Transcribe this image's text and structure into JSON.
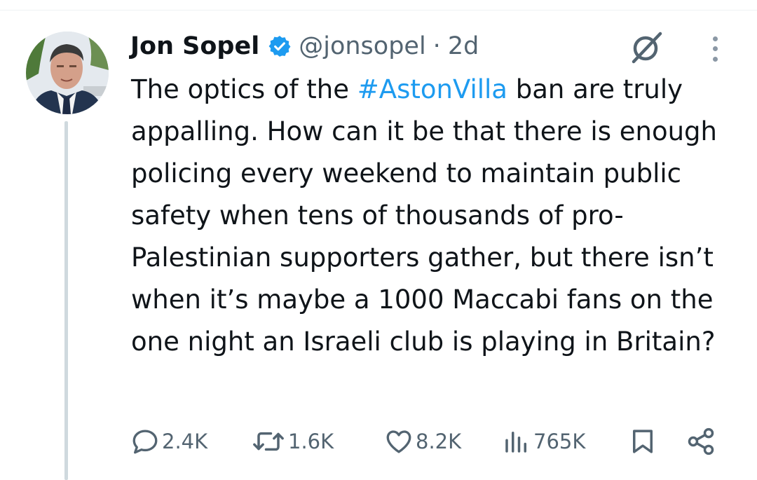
{
  "tweet": {
    "author": {
      "display_name": "Jon Sopel",
      "handle": "@jonsopel",
      "separator": "·",
      "age": "2d"
    },
    "text": {
      "before_hashtag": "The optics of the ",
      "hashtag": "#AstonVilla",
      "after_hashtag": " ban are truly appalling. How can it be that there is enough policing every weekend to maintain public safety when tens of thousands of pro-Palestinian supporters gather, but there isn’t when it’s maybe a 1000 Maccabi fans on the one night an Israeli club is playing in Britain?"
    },
    "actions": {
      "replies": "2.4K",
      "reposts": "1.6K",
      "likes": "8.2K",
      "views": "765K"
    }
  },
  "icons": {
    "verified": "verified-badge-icon",
    "grok": "grok-icon",
    "more": "more-options-icon",
    "reply": "reply-icon",
    "repost": "repost-icon",
    "like": "heart-icon",
    "views": "views-chart-icon",
    "bookmark": "bookmark-icon",
    "share": "share-icon"
  },
  "colors": {
    "link": "#1d9bf0",
    "text": "#0f1419",
    "secondary": "#536471",
    "divider": "#cfd9de"
  }
}
